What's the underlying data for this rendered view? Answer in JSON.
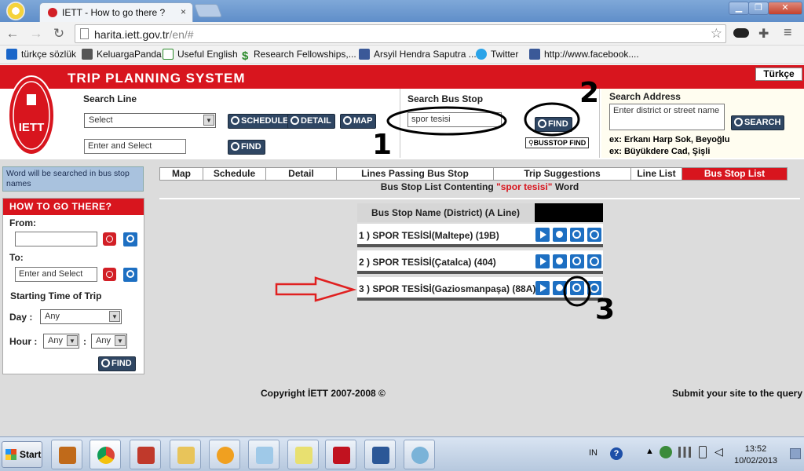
{
  "browser": {
    "tab_title": "IETT - How to go there ?",
    "tab_close": "×",
    "url_host": "harita.iett.gov.tr",
    "url_path": "/en/#",
    "window_minimize": "▁",
    "window_restore": "❐",
    "window_close": "✕"
  },
  "bookmarks": [
    {
      "label": "türkçe sözlük",
      "icon": "s-icon",
      "color": "#1a66c9"
    },
    {
      "label": "KeluargaPanda",
      "icon": "panda-icon",
      "color": "#555555"
    },
    {
      "label": "Useful English",
      "icon": "checkbox-icon",
      "color": "#2a8a2a"
    },
    {
      "label": "Research Fellowships,...",
      "icon": "dollar-icon",
      "color": "#2a8a2a"
    },
    {
      "label": "Arsyil Hendra Saputra ...",
      "icon": "facebook-icon",
      "color": "#3b5998"
    },
    {
      "label": "Twitter",
      "icon": "twitter-icon",
      "color": "#2aa3e8"
    },
    {
      "label": "http://www.facebook....",
      "icon": "facebook-icon",
      "color": "#3b5998"
    }
  ],
  "header": {
    "system_title": "TRIP PLANNING SYSTEM",
    "language_button": "Türkçe",
    "logo_text": "IETT"
  },
  "search_line": {
    "title": "Search Line",
    "select_value": "Select",
    "input_placeholder": "Enter and Select",
    "schedule_button": "SCHEDULE",
    "detail_button": "DETAIL",
    "map_button": "MAP",
    "find_button": "FIND"
  },
  "search_stop": {
    "title": "Search Bus Stop",
    "input_value": "spor tesisi",
    "find_button": "FIND",
    "busstop_find_button": "BUSSTOP FIND"
  },
  "search_address": {
    "title": "Search Address",
    "input_placeholder": "Enter district or street name",
    "search_button": "SEARCH",
    "example_1": "ex: Erkanı Harp Sok, Beyoğlu",
    "example_2": "ex: Büyükdere Cad, Şişli"
  },
  "hint": "Word will be searched in bus stop names",
  "how_to_go": {
    "title": "HOW TO GO THERE?",
    "from_label": "From:",
    "to_label": "To:",
    "to_placeholder": "Enter and Select",
    "starting_time_label": "Starting Time of Trip",
    "day_label": "Day :",
    "day_value": "Any",
    "hour_label": "Hour :",
    "hour_value": "Any",
    "minute_sep": ":",
    "minute_value": "Any",
    "find_button": "FIND"
  },
  "tabs": [
    "Map",
    "Schedule",
    "Detail",
    "Lines Passing Bus Stop",
    "Trip Suggestions",
    "Line List",
    "Bus Stop List"
  ],
  "results": {
    "title_prefix": "Bus Stop List Contenting",
    "query": "\"spor tesisi\"",
    "title_suffix": "Word",
    "column_header": "Bus Stop Name (District) (A Line)",
    "rows": [
      "1 )  SPOR TESİSİ(Maltepe) (19B)",
      "2 )  SPOR TESİSİ(Çatalca) (404)",
      "3 )  SPOR TESİSİ(Gaziosmanpaşa) (88A)"
    ]
  },
  "footer": {
    "copyright": "Copyright İETT 2007-2008 ©",
    "submit": "Submit your site to the query"
  },
  "annotations": {
    "one": "1",
    "two": "2",
    "three": "3"
  },
  "taskbar": {
    "start_label": "Start",
    "language": "IN",
    "time": "13:52",
    "date": "10/02/2013"
  },
  "colors": {
    "brand_red": "#d8151e",
    "button_navy": "#2f4663",
    "action_blue": "#1d6fc2"
  }
}
